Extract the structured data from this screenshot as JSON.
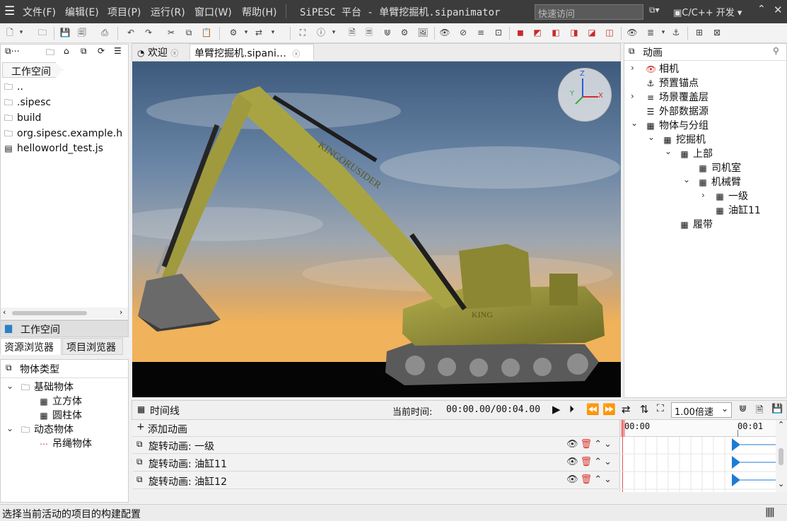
{
  "menubar": {
    "items": [
      "文件(F)",
      "编辑(E)",
      "项目(P)",
      "运行(R)",
      "窗口(W)",
      "帮助(H)"
    ],
    "title": "SiPESC 平台 - 单臂挖掘机.sipanimator",
    "quick_access_placeholder": "快速访问",
    "perspective": "C/C++ 开发"
  },
  "left_top": {
    "breadcrumb": "工作空间",
    "files": [
      "..",
      ".sipesc",
      "build",
      "org.sipesc.example.h",
      "helloworld_test.js"
    ]
  },
  "left_mid": {
    "title": "工作空间",
    "tabs": [
      "资源浏览器",
      "项目浏览器"
    ]
  },
  "left_bottom": {
    "title": "物体类型",
    "groups": [
      {
        "label": "基础物体",
        "items": [
          "立方体",
          "圆柱体"
        ]
      },
      {
        "label": "动态物体",
        "items": [
          "吊绳物体"
        ]
      }
    ]
  },
  "editor": {
    "tabs": [
      "欢迎",
      "单臂挖掘机.sipani…"
    ],
    "model_brand": "KINGORUSIDER",
    "model_brand_small": "KING",
    "axes": {
      "x": "X",
      "y": "Y",
      "z": "Z"
    }
  },
  "right_panel": {
    "title": "动画",
    "nodes": [
      "相机",
      "预置锚点",
      "场景覆盖层",
      "外部数据源",
      "物体与分组",
      "挖掘机",
      "上部",
      "司机室",
      "机械臂",
      "一级",
      "油缸11",
      "履带"
    ]
  },
  "timeline": {
    "title": "时间线",
    "current_time_label": "当前时间:",
    "current_time": "00:00.00/00:04.00",
    "speed": "1.00倍速",
    "add_animation": "添加动画",
    "ruler": [
      "00:00",
      "00:01"
    ],
    "rows": [
      "旋转动画: 一级",
      "旋转动画: 油缸11",
      "旋转动画: 油缸12"
    ]
  },
  "status": {
    "message": "选择当前活动的项目的构建配置"
  },
  "colors": {
    "title_bg": "#3c3c3c",
    "excavator_body": "#8f8a32",
    "keyframe": "#1e7bd6",
    "delete_icon": "#d9342b"
  }
}
